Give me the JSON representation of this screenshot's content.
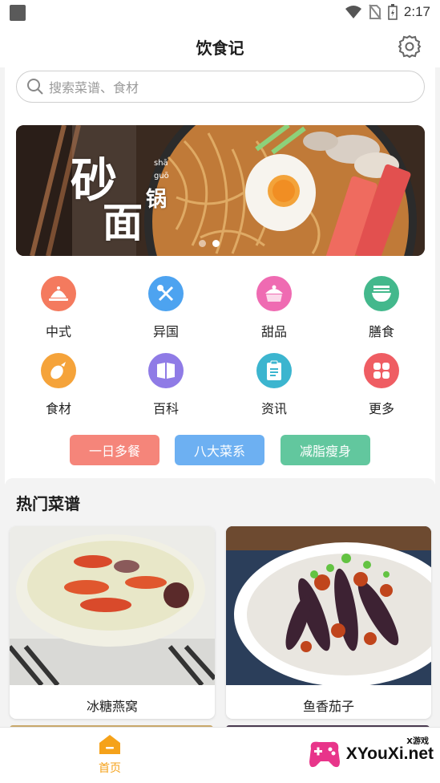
{
  "status_bar": {
    "time": "2:17"
  },
  "header": {
    "title": "饮食记"
  },
  "search": {
    "placeholder": "搜索菜谱、食材"
  },
  "banner": {
    "big_char1": "砂",
    "big_char2": "面",
    "small_char": "锅",
    "pinyin1": "shā",
    "pinyin2": "guō",
    "slides": 2,
    "active_slide": 1
  },
  "categories": [
    {
      "label": "中式",
      "icon": "cloche-icon",
      "color": "#f47a5e"
    },
    {
      "label": "异国",
      "icon": "fork-knife-icon",
      "color": "#4da3f0"
    },
    {
      "label": "甜品",
      "icon": "cake-icon",
      "color": "#ef6bb2"
    },
    {
      "label": "膳食",
      "icon": "bowl-icon",
      "color": "#43b88c"
    },
    {
      "label": "食材",
      "icon": "eggplant-icon",
      "color": "#f5a33a"
    },
    {
      "label": "百科",
      "icon": "book-icon",
      "color": "#8f7be6"
    },
    {
      "label": "资讯",
      "icon": "clipboard-icon",
      "color": "#3cb5cf"
    },
    {
      "label": "更多",
      "icon": "grid-icon",
      "color": "#ef5d63"
    }
  ],
  "tags": [
    {
      "label": "一日多餐",
      "color": "#f5857a"
    },
    {
      "label": "八大菜系",
      "color": "#6db0f2"
    },
    {
      "label": "减脂瘦身",
      "color": "#62c79e"
    }
  ],
  "hot": {
    "title": "热门菜谱",
    "recipes": [
      {
        "name": "冰糖燕窝"
      },
      {
        "name": "鱼香茄子"
      }
    ]
  },
  "bottom_nav": {
    "home_label": "首页",
    "accent": "#f5a21a"
  },
  "watermark": {
    "text": "XYouXi.net",
    "small": "X游戏"
  }
}
